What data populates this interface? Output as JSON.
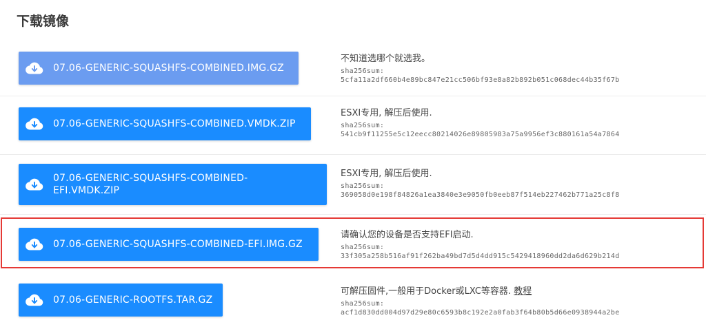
{
  "page": {
    "title": "下载镜像"
  },
  "hash_label": "sha256sum:",
  "colors": {
    "button": "#1a8cff",
    "button_hover": "#6b9cf0",
    "highlight": "#e53935"
  },
  "downloads": [
    {
      "label": "07.06-GENERIC-SQUASHFS-COMBINED.IMG.GZ",
      "description": "不知道选哪个就选我。",
      "sha256": "5cfa11a2df660b4e89bc847e21cc506bf93e8a82b892b051c068dec44b35f67b",
      "icon": "cloud-download-icon"
    },
    {
      "label": "07.06-GENERIC-SQUASHFS-COMBINED.VMDK.ZIP",
      "description": "ESXI专用, 解压后使用.",
      "sha256": "541cb9f11255e5c12eecc80214026e89805983a75a9956ef3c880161a54a7864",
      "icon": "cloud-download-icon"
    },
    {
      "label_line1": "07.06-GENERIC-SQUASHFS-COMBINED-",
      "label_line2": "EFI.VMDK.ZIP",
      "description": "ESXI专用, 解压后使用.",
      "sha256": "369058d0e198f84826a1ea3840e3e9050fb0eeb87f514eb227462b771a25c8f8",
      "icon": "cloud-download-icon"
    },
    {
      "label": "07.06-GENERIC-SQUASHFS-COMBINED-EFI.IMG.GZ",
      "description": "请确认您的设备是否支持EFI启动.",
      "sha256": "33f305a258b516af91f262ba49bd7d5d4dd915c5429418960dd2da6d629b214d",
      "icon": "cloud-download-icon"
    },
    {
      "label": "07.06-GENERIC-ROOTFS.TAR.GZ",
      "description": "可解压固件,一般用于Docker或LXC等容器.",
      "link_text": "教程",
      "sha256": "acf1d830dd004d97d29e80c6593b8c192e2a0fab3f64b80b5d66e0938944a2be",
      "icon": "cloud-download-icon"
    }
  ]
}
